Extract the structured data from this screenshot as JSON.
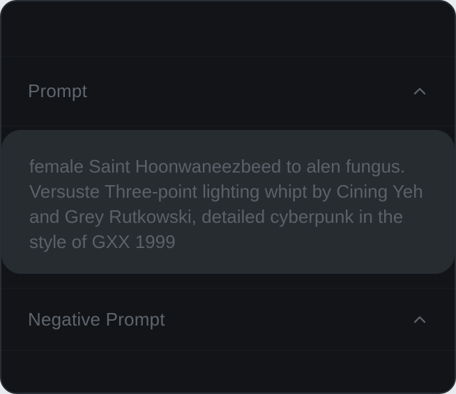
{
  "panel": {
    "prompt_section": {
      "title": "Prompt",
      "toggle_icon": "chevron-up-icon"
    },
    "prompt_text": "female Saint Hoonwaneezbeed to alen fungus. Versuste Three-point lighting whipt by Cining Yeh and Grey Rutkowski, detailed cyberpunk in the style of GXX 1999",
    "negative_prompt_section": {
      "title": "Negative Prompt",
      "toggle_icon": "chevron-up-icon"
    }
  },
  "colors": {
    "background": "#121417",
    "prompt_box": "#272c31",
    "text": "#5b6168"
  }
}
